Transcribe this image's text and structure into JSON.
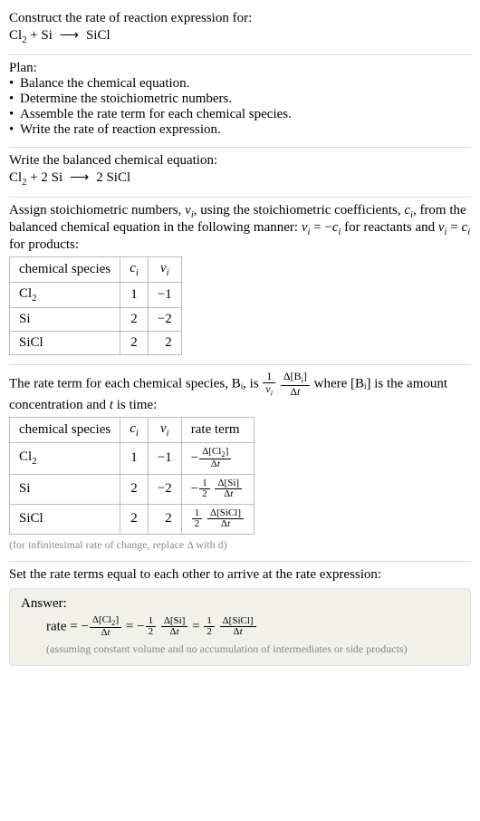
{
  "intro": {
    "prompt": "Construct the rate of reaction expression for:",
    "equation": "Cl₂ + Si ⟶ SiCl"
  },
  "plan": {
    "heading": "Plan:",
    "items": [
      "Balance the chemical equation.",
      "Determine the stoichiometric numbers.",
      "Assemble the rate term for each chemical species.",
      "Write the rate of reaction expression."
    ]
  },
  "balanced": {
    "heading": "Write the balanced chemical equation:",
    "equation": "Cl₂ + 2 Si ⟶ 2 SiCl"
  },
  "stoich": {
    "text_part1": "Assign stoichiometric numbers, ",
    "nu": "ν",
    "text_part2": ", using the stoichiometric coefficients, ",
    "c": "c",
    "text_part3": ", from the balanced chemical equation in the following manner: ",
    "rel_reactants": "νᵢ = −cᵢ",
    "for_reactants": " for reactants and ",
    "rel_products": "νᵢ = cᵢ",
    "for_products": " for products:",
    "table": {
      "headers": [
        "chemical species",
        "cᵢ",
        "νᵢ"
      ],
      "rows": [
        {
          "species": "Cl₂",
          "c": "1",
          "nu": "−1"
        },
        {
          "species": "Si",
          "c": "2",
          "nu": "−2"
        },
        {
          "species": "SiCl",
          "c": "2",
          "nu": "2"
        }
      ]
    }
  },
  "rate_term": {
    "pre": "The rate term for each chemical species, Bᵢ, is ",
    "frac1_num": "1",
    "frac1_den": "νᵢ",
    "frac2_num": "Δ[Bᵢ]",
    "frac2_den": "Δt",
    "mid": " where [Bᵢ] is the amount concentration and ",
    "tvar": "t",
    "post": " is time:",
    "table": {
      "headers": [
        "chemical species",
        "cᵢ",
        "νᵢ",
        "rate term"
      ],
      "rows": [
        {
          "species": "Cl₂",
          "c": "1",
          "nu": "−1",
          "term_prefix": "−",
          "term_coef_num": "",
          "term_coef_den": "",
          "term_num": "Δ[Cl₂]",
          "term_den": "Δt"
        },
        {
          "species": "Si",
          "c": "2",
          "nu": "−2",
          "term_prefix": "−",
          "term_coef_num": "1",
          "term_coef_den": "2",
          "term_num": "Δ[Si]",
          "term_den": "Δt"
        },
        {
          "species": "SiCl",
          "c": "2",
          "nu": "2",
          "term_prefix": "",
          "term_coef_num": "1",
          "term_coef_den": "2",
          "term_num": "Δ[SiCl]",
          "term_den": "Δt"
        }
      ]
    },
    "note": "(for infinitesimal rate of change, replace Δ with d)"
  },
  "final": {
    "heading": "Set the rate terms equal to each other to arrive at the rate expression:",
    "answer_label": "Answer:",
    "rate_label": "rate = ",
    "t1_prefix": "−",
    "t1_num": "Δ[Cl₂]",
    "t1_den": "Δt",
    "eq1": " = ",
    "t2_prefix": "−",
    "t2_coef_num": "1",
    "t2_coef_den": "2",
    "t2_num": "Δ[Si]",
    "t2_den": "Δt",
    "eq2": " = ",
    "t3_coef_num": "1",
    "t3_coef_den": "2",
    "t3_num": "Δ[SiCl]",
    "t3_den": "Δt",
    "assume": "(assuming constant volume and no accumulation of intermediates or side products)"
  }
}
